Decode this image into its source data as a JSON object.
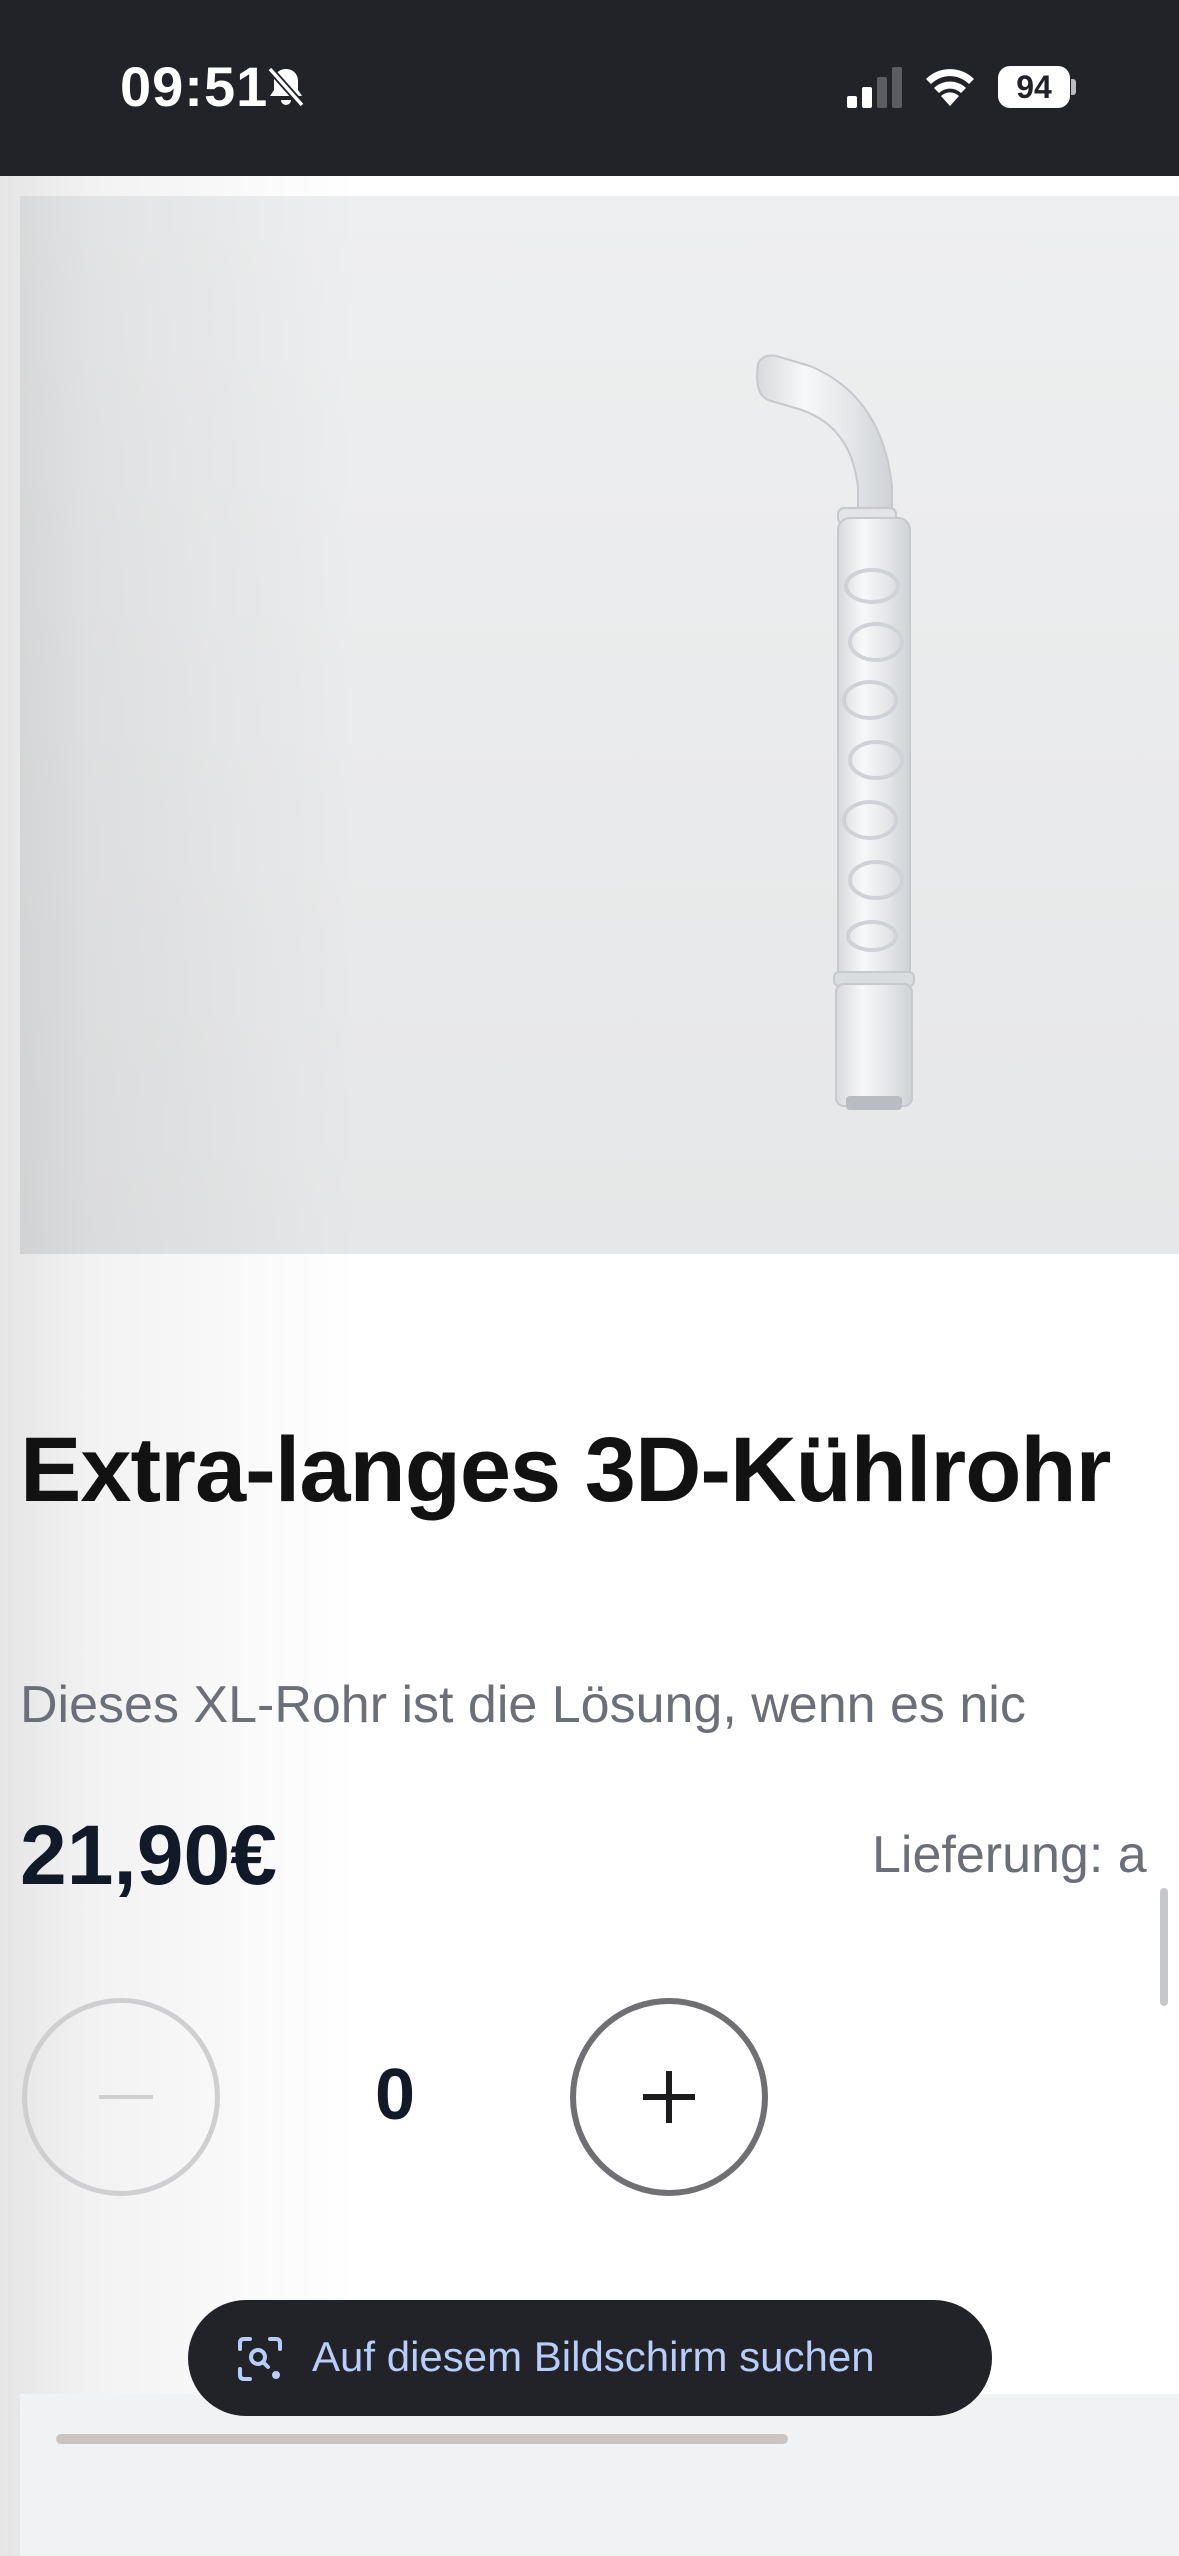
{
  "status_bar": {
    "time": "09:51",
    "battery_level": "94",
    "signal_strength": 2,
    "icons": [
      "bell-slash-icon",
      "signal-icon",
      "wifi-icon",
      "battery-icon"
    ]
  },
  "product": {
    "image_icon": "glass-cooling-tube-image",
    "title": "Extra-langes 3D-Kühlrohr",
    "description": "Dieses XL-Rohr ist die Lösung, wenn es nic",
    "price": "21,90€",
    "delivery_text": "Lieferung: a"
  },
  "quantity": {
    "value": "0",
    "minus_icon": "minus-icon",
    "plus_icon": "plus-icon"
  },
  "lens": {
    "label": "Auf diesem Bildschirm suchen",
    "icon": "lens-search-icon",
    "text_color": "#b9cdfa"
  },
  "colors": {
    "status_bar_bg": "#212329",
    "pill_bg": "#212329",
    "price_text": "#121a2a",
    "muted_text": "#6b6f78"
  }
}
